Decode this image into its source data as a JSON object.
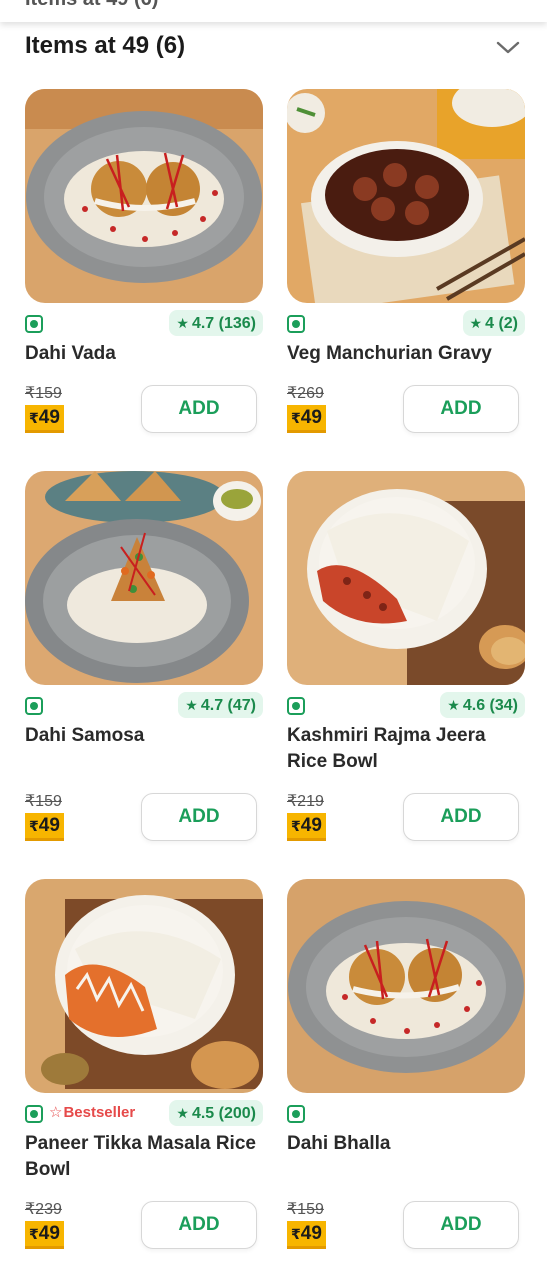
{
  "header": {
    "prev_title_partial": "Items at 49 (6)",
    "title": "Items at 49 (6)",
    "collapse_icon": "chevron-down-icon"
  },
  "items": [
    {
      "name": "Dahi Vada",
      "rating": "4.7 (136)",
      "old_price": "₹159",
      "price": "49",
      "currency": "₹",
      "add_label": "ADD",
      "veg": true
    },
    {
      "name": "Veg Manchurian Gravy",
      "rating": "4 (2)",
      "old_price": "₹269",
      "price": "49",
      "currency": "₹",
      "add_label": "ADD",
      "veg": true
    },
    {
      "name": "Dahi Samosa",
      "rating": "4.7 (47)",
      "old_price": "₹159",
      "price": "49",
      "currency": "₹",
      "add_label": "ADD",
      "veg": true
    },
    {
      "name": "Kashmiri Rajma Jeera Rice Bowl",
      "rating": "4.6 (34)",
      "old_price": "₹219",
      "price": "49",
      "currency": "₹",
      "add_label": "ADD",
      "veg": true
    },
    {
      "name": "Paneer Tikka Masala Rice Bowl",
      "badge": "Bestseller",
      "rating": "4.5 (200)",
      "old_price": "₹239",
      "price": "49",
      "currency": "₹",
      "add_label": "ADD",
      "veg": true
    },
    {
      "name": "Dahi Bhalla",
      "old_price": "₹159",
      "price": "49",
      "currency": "₹",
      "add_label": "ADD",
      "veg": true
    }
  ],
  "colors": {
    "accent_green": "#1b9e5a",
    "price_tag": "#f7b500",
    "bestseller_red": "#e64a4a",
    "rating_bg": "#e3f6ec"
  }
}
